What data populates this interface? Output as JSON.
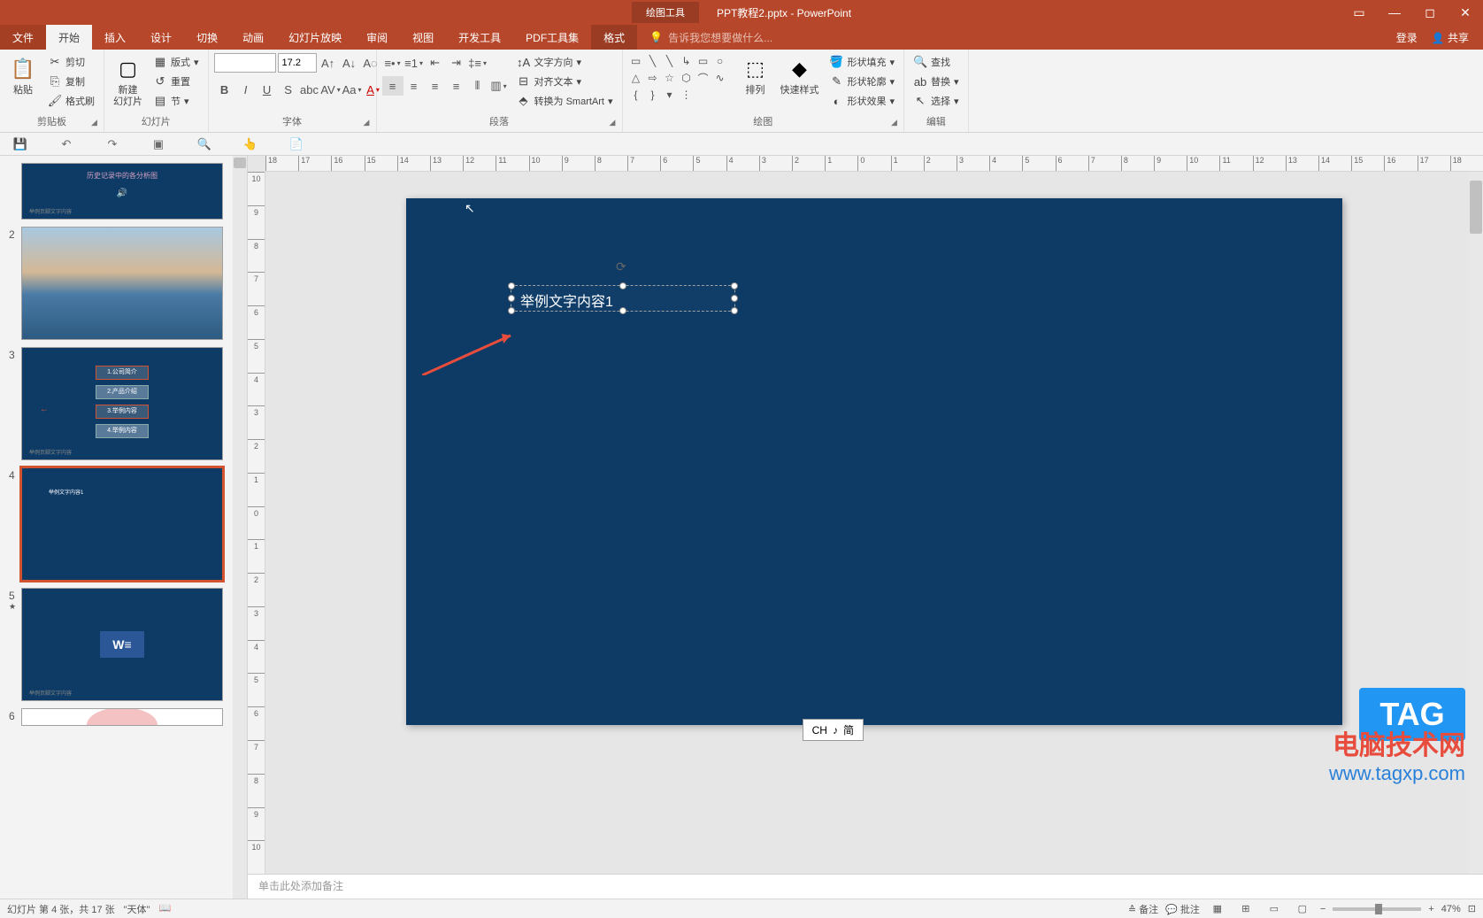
{
  "title_bar": {
    "contextual_tab": "绘图工具",
    "filename": "PPT教程2.pptx - PowerPoint"
  },
  "tabs": {
    "file": "文件",
    "home": "开始",
    "insert": "插入",
    "design": "设计",
    "transitions": "切换",
    "animations": "动画",
    "slideshow": "幻灯片放映",
    "review": "审阅",
    "view": "视图",
    "developer": "开发工具",
    "pdf": "PDF工具集",
    "format": "格式",
    "tellme_placeholder": "告诉我您想要做什么...",
    "login": "登录",
    "share": "共享"
  },
  "ribbon": {
    "clipboard": {
      "paste": "粘贴",
      "cut": "剪切",
      "copy": "复制",
      "format_painter": "格式刷",
      "label": "剪贴板"
    },
    "slides": {
      "new_slide": "新建\n幻灯片",
      "layout": "版式",
      "reset": "重置",
      "section": "节",
      "label": "幻灯片"
    },
    "font": {
      "size": "17.2",
      "label": "字体"
    },
    "paragraph": {
      "text_direction": "文字方向",
      "align_text": "对齐文本",
      "smartart": "转换为 SmartArt",
      "label": "段落"
    },
    "drawing": {
      "arrange": "排列",
      "quick_styles": "快速样式",
      "shape_fill": "形状填充",
      "shape_outline": "形状轮廓",
      "shape_effects": "形状效果",
      "label": "绘图"
    },
    "editing": {
      "find": "查找",
      "replace": "替换",
      "select": "选择",
      "label": "编辑"
    }
  },
  "slide": {
    "textbox_content": "举例文字内容1"
  },
  "thumbnails": {
    "s1_title": "历史记录中的各分析图",
    "s3_items": [
      "1.公司简介",
      "2.产品介绍",
      "3.举例内容",
      "4.举例内容"
    ],
    "s5_word": "W"
  },
  "notes_placeholder": "单击此处添加备注",
  "status": {
    "slide_info": "幻灯片 第 4 张，共 17 张",
    "theme": "\"天体\"",
    "notes_btn": "备注",
    "comments_btn": "批注",
    "zoom_pct": "47%"
  },
  "ime": {
    "lang": "CH",
    "mode": "简"
  },
  "watermark": {
    "line1": "电脑技术网",
    "line2": "www.tagxp.com",
    "tag": "TAG"
  },
  "ruler_h": [
    "18",
    "17",
    "16",
    "15",
    "14",
    "13",
    "12",
    "11",
    "10",
    "9",
    "8",
    "7",
    "6",
    "5",
    "4",
    "3",
    "2",
    "1",
    "0",
    "1",
    "2",
    "3",
    "4",
    "5",
    "6",
    "7",
    "8",
    "9",
    "10",
    "11",
    "12",
    "13",
    "14",
    "15",
    "16",
    "17",
    "18"
  ],
  "ruler_v": [
    "10",
    "9",
    "8",
    "7",
    "6",
    "5",
    "4",
    "3",
    "2",
    "1",
    "0",
    "1",
    "2",
    "3",
    "4",
    "5",
    "6",
    "7",
    "8",
    "9",
    "10"
  ]
}
